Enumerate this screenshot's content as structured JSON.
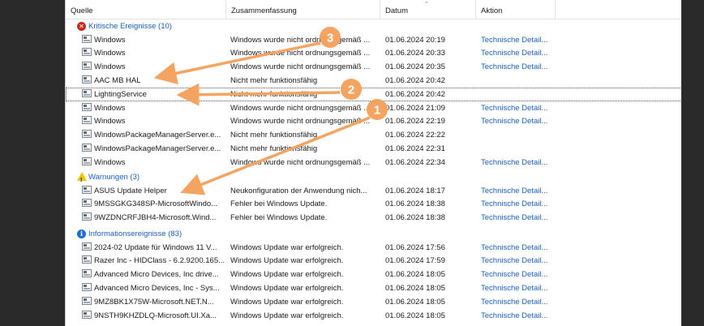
{
  "columns": {
    "source": "Quelle",
    "summary": "Zusammenfassung",
    "date": "Datum",
    "action": "Aktion"
  },
  "groups": {
    "critical": {
      "label": "Kritische Ereignisse (10)",
      "icon": "error-icon",
      "color": "#c42b1c"
    },
    "warnings": {
      "label": "Warnungen (3)",
      "icon": "warning-icon",
      "color": "#f2c500"
    },
    "info": {
      "label": "Informationsereignisse (83)",
      "icon": "info-icon",
      "color": "#1a6fd6"
    }
  },
  "critical_rows": [
    {
      "source": "Windows",
      "summary": "Windows wurde nicht ordnungsgemäß ...",
      "date": "01.06.2024 20:19",
      "action": "Technische Detail..."
    },
    {
      "source": "Windows",
      "summary": "Windows wurde nicht ordnungsgemäß ...",
      "date": "01.06.2024 20:33",
      "action": "Technische Detail..."
    },
    {
      "source": "Windows",
      "summary": "Windows wurde nicht ordnungsgemäß ...",
      "date": "01.06.2024 20:35",
      "action": "Technische Detail..."
    },
    {
      "source": "AAC MB HAL",
      "summary": "Nicht mehr funktionsfähig",
      "date": "01.06.2024 20:42",
      "action": ""
    },
    {
      "source": "LightingService",
      "summary": "Nicht mehr funktionsfähig",
      "date": "01.06.2024 20:42",
      "action": ""
    },
    {
      "source": "Windows",
      "summary": "Windows wurde nicht ordnungsgemäß ...",
      "date": "01.06.2024 21:09",
      "action": "Technische Detail..."
    },
    {
      "source": "Windows",
      "summary": "Windows wurde nicht ordnungsgemäß ...",
      "date": "01.06.2024 22:19",
      "action": "Technische Detail..."
    },
    {
      "source": "WindowsPackageManagerServer.e...",
      "summary": "Nicht mehr funktionsfähig",
      "date": "01.06.2024 22:22",
      "action": ""
    },
    {
      "source": "WindowsPackageManagerServer.e...",
      "summary": "Nicht mehr funktionsfähig",
      "date": "01.06.2024 22:31",
      "action": ""
    },
    {
      "source": "Windows",
      "summary": "Windows wurde nicht ordnungsgemäß ...",
      "date": "01.06.2024 22:34",
      "action": "Technische Detail..."
    }
  ],
  "warning_rows": [
    {
      "source": "ASUS Update Helper",
      "summary": "Neukonfiguration der Anwendung nich...",
      "date": "01.06.2024 18:17",
      "action": "Technische Detail..."
    },
    {
      "source": "9MSSGKG348SP-MicrosoftWindo...",
      "summary": "Fehler bei Windows Update.",
      "date": "01.06.2024 18:38",
      "action": "Technische Detail..."
    },
    {
      "source": "9WZDNCRFJBH4-Microsoft.Wind...",
      "summary": "Fehler bei Windows Update.",
      "date": "01.06.2024 18:38",
      "action": "Technische Detail..."
    }
  ],
  "info_rows": [
    {
      "source": "2024-02 Update für Windows 11 V...",
      "summary": "Windows Update war erfolgreich.",
      "date": "01.06.2024 17:56",
      "action": "Technische Detail..."
    },
    {
      "source": "Razer Inc - HIDClass - 6.2.9200.165...",
      "summary": "Windows Update war erfolgreich.",
      "date": "01.06.2024 17:59",
      "action": "Technische Detail..."
    },
    {
      "source": "Advanced Micro Devices, Inc drive...",
      "summary": "Windows Update war erfolgreich.",
      "date": "01.06.2024 18:05",
      "action": "Technische Detail..."
    },
    {
      "source": "Advanced Micro Devices, Inc - Sys...",
      "summary": "Windows Update war erfolgreich.",
      "date": "01.06.2024 18:05",
      "action": "Technische Detail..."
    },
    {
      "source": "9MZ8BK1X75W-Microsoft.NET.N...",
      "summary": "Windows Update war erfolgreich.",
      "date": "01.06.2024 18:05",
      "action": "Technische Detail..."
    },
    {
      "source": "9NSTH9KHZDLQ-Microsoft.UI.Xa...",
      "summary": "Windows Update war erfolgreich.",
      "date": "01.06.2024 18:05",
      "action": "Technische Detail..."
    }
  ],
  "callouts": [
    {
      "number": "1",
      "color": "#f4a460"
    },
    {
      "number": "2",
      "color": "#f4a460"
    },
    {
      "number": "3",
      "color": "#f4a460"
    }
  ]
}
